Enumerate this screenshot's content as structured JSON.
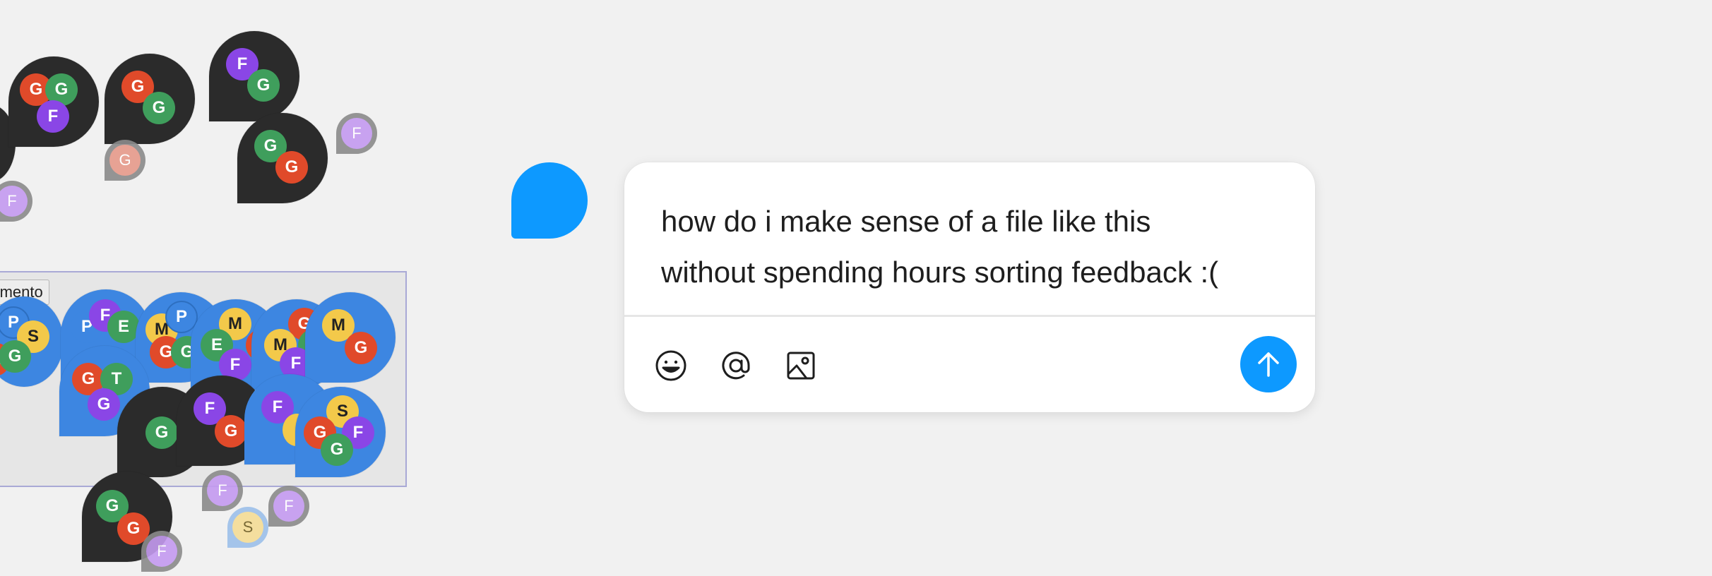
{
  "canvas": {
    "section_label": "ntamento",
    "colors": {
      "background": "#f1f1f1",
      "accent": "#0d99ff",
      "cluster_dark": "#2b2b2b",
      "cluster_blue": "#3d86e1",
      "avatar_green": "#3f9e5c",
      "avatar_red": "#e04a2a",
      "avatar_purple": "#8a46e6",
      "avatar_yellow": "#f3c94a"
    },
    "clusters": {
      "c1": [
        "G",
        "G",
        "F"
      ],
      "c2": [
        "G",
        "G"
      ],
      "c3": [
        "F",
        "G"
      ],
      "c4": [
        "G",
        "G"
      ],
      "c5": [
        "P",
        "S",
        "G",
        "G"
      ],
      "c6": [
        "P",
        "F",
        "E"
      ],
      "c7": [
        "P",
        "M",
        "G",
        "G"
      ],
      "c8": [
        "M",
        "E",
        "F",
        "G"
      ],
      "c9": [
        "G",
        "M",
        "F",
        "G"
      ],
      "c10": [
        "M",
        "G"
      ],
      "c11": [
        "G",
        "T",
        "G"
      ],
      "c12": [
        "G"
      ],
      "c13": [
        "F",
        "G"
      ],
      "c14": [
        "F"
      ],
      "c15": [
        "S",
        "G",
        "F",
        "G"
      ],
      "c16": [
        "G",
        "G",
        "F"
      ]
    },
    "pins": {
      "p1": "G",
      "p2": "F",
      "p3": "F",
      "p4": "F",
      "p5": "S",
      "p6": "F"
    }
  },
  "composer": {
    "text_line1": "how do i make sense of a file like this",
    "text_line2": "without spending hours sorting feedback :(",
    "tools": {
      "emoji": "emoji-icon",
      "mention": "mention-icon",
      "image": "image-icon"
    },
    "send": "arrow-up-icon"
  }
}
